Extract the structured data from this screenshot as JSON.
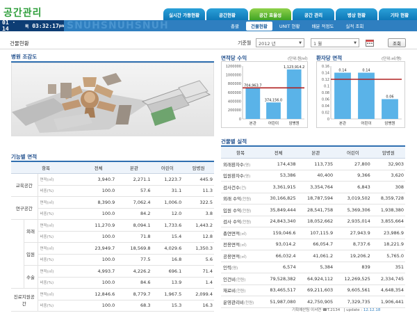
{
  "header": {
    "title": "공간관리",
    "tabs": [
      "실시간 가동현황",
      "공간현황",
      "공간 효율성",
      "공간 관리",
      "병상 현황",
      "기타 현황"
    ],
    "active_tab": 2,
    "clock": {
      "date": "01 · 14",
      "day": "목",
      "time": "03:32:17",
      "ampm": "pm"
    },
    "watermark": "SNUHSNUHSNUH",
    "subnav": [
      "총괄",
      "건물현황",
      "UNIT 현황",
      "배분 적정도",
      "실적 조회"
    ],
    "active_sub": 1
  },
  "filter": {
    "page_title": "건물현황",
    "year_label": "기준월",
    "year": "2012 년",
    "month": "1 월",
    "search": "조회"
  },
  "sections": {
    "map": "병원 조감도",
    "area_table": "기능별 면적",
    "rev_chart": "면적당 수익",
    "patient_chart": "환자당 면적",
    "perf_table": "건물별 실적"
  },
  "units": {
    "rev": "(단위:원/㎡)",
    "pat": "(단위:㎡/명)"
  },
  "colors": {
    "bar": "#5ab3e8",
    "ref_line": "#b02020",
    "header_blue": "#2f7fc0",
    "active_green": "#5cb82f"
  },
  "chart_data": [
    {
      "type": "bar",
      "title": "면적당 수익",
      "categories": [
        "본관",
        "어린이",
        "암병원"
      ],
      "values": [
        704963.7,
        374156.0,
        1123914.2
      ],
      "value_labels": [
        "704,963.7",
        "374,156.0",
        "1,123,914.2"
      ],
      "yticks": [
        "0",
        "200000",
        "400000",
        "600000",
        "800000",
        "1000000",
        "1200000"
      ],
      "ylim": [
        0,
        1200000
      ],
      "ref_line": 704963.7
    },
    {
      "type": "bar",
      "title": "환자당 면적",
      "categories": [
        "본관",
        "어린이",
        "암병원"
      ],
      "values": [
        0.14,
        0.14,
        0.06
      ],
      "value_labels": [
        "0.14",
        "0.14",
        "0.06"
      ],
      "yticks": [
        "0",
        "0.02",
        "0.04",
        "0.06",
        "0.08",
        "0.1",
        "0.12",
        "0.14",
        "0.16"
      ],
      "ylim": [
        0,
        0.16
      ],
      "ref_line": 0.12
    }
  ],
  "area_table": {
    "headers": [
      "항목",
      "",
      "전체",
      "본관",
      "어린이",
      "암병원"
    ],
    "rows": [
      {
        "g1": "교육공간",
        "g2": "",
        "m": "면적(㎡)",
        "v": [
          "3,940.7",
          "2,271.1",
          "1,223.7",
          "445.9"
        ]
      },
      {
        "g1": "",
        "g2": "",
        "m": "비중(%)",
        "v": [
          "100.0",
          "57.6",
          "31.1",
          "11.3"
        ]
      },
      {
        "g1": "연구공간",
        "g2": "",
        "m": "면적(㎡)",
        "v": [
          "8,390.9",
          "7,062.4",
          "1,006.0",
          "322.5"
        ]
      },
      {
        "g1": "",
        "g2": "",
        "m": "비중(%)",
        "v": [
          "100.0",
          "84.2",
          "12.0",
          "3.8"
        ]
      },
      {
        "g1": "",
        "g2": "외래",
        "m": "면적(㎡)",
        "v": [
          "11,270.9",
          "8,094.1",
          "1,733.6",
          "1,443.2"
        ]
      },
      {
        "g1": "",
        "g2": "",
        "m": "비중(%)",
        "v": [
          "100.0",
          "71.8",
          "15.4",
          "12.8"
        ]
      },
      {
        "g1": "진료공간",
        "g2": "입원",
        "m": "면적(㎡)",
        "v": [
          "23,949.7",
          "18,569.8",
          "4,029.6",
          "1,350.3"
        ]
      },
      {
        "g1": "",
        "g2": "",
        "m": "비중(%)",
        "v": [
          "100.0",
          "77.5",
          "16.8",
          "5.6"
        ]
      },
      {
        "g1": "",
        "g2": "수술",
        "m": "면적(㎡)",
        "v": [
          "4,993.7",
          "4,226.2",
          "696.1",
          "71.4"
        ]
      },
      {
        "g1": "",
        "g2": "",
        "m": "비중(%)",
        "v": [
          "100.0",
          "84.6",
          "13.9",
          "1.4"
        ]
      },
      {
        "g1": "진료지원공간",
        "g2": "",
        "m": "면적(㎡)",
        "v": [
          "12,846.6",
          "8,779.7",
          "1,967.5",
          "2,099.4"
        ]
      },
      {
        "g1": "",
        "g2": "",
        "m": "비중(%)",
        "v": [
          "100.0",
          "68.3",
          "15.3",
          "16.3"
        ]
      }
    ]
  },
  "perf_table": {
    "headers": [
      "항목",
      "전체",
      "본관",
      "어린이",
      "암병원"
    ],
    "rows": [
      {
        "n": "외래환자수",
        "u": "(명)",
        "v": [
          "174,438",
          "113,735",
          "27,800",
          "32,903"
        ]
      },
      {
        "n": "입원환자수",
        "u": "(명)",
        "v": [
          "53,386",
          "40,400",
          "9,366",
          "3,620"
        ]
      },
      {
        "n": "검사건수",
        "u": "(건)",
        "v": [
          "3,361,915",
          "3,354,764",
          "6,843",
          "308"
        ]
      },
      {
        "n": "외래 수익",
        "u": "(천원)",
        "v": [
          "30,166,825",
          "18,787,594",
          "3,019,502",
          "8,359,728"
        ]
      },
      {
        "n": "입원 수익",
        "u": "(천원)",
        "v": [
          "35,849,444",
          "28,541,758",
          "5,369,306",
          "1,938,380"
        ]
      },
      {
        "n": "검사 수익",
        "u": "(천원)",
        "v": [
          "24,843,340",
          "18,052,662",
          "2,935,014",
          "3,855,664"
        ]
      },
      {
        "n": "총연면적",
        "u": "(㎡)",
        "v": [
          "159,046.6",
          "107,115.9",
          "27,943.9",
          "23,986.9"
        ]
      },
      {
        "n": "전용면적",
        "u": "(㎡)",
        "v": [
          "93,014.2",
          "66,054.7",
          "8,737.6",
          "18,221.9"
        ]
      },
      {
        "n": "공용면적",
        "u": "(㎡)",
        "v": [
          "66,032.4",
          "41,061.2",
          "19,206.2",
          "5,765.0"
        ]
      },
      {
        "n": "인력",
        "u": "(명)",
        "v": [
          "6,574",
          "5,384",
          "839",
          "351"
        ]
      },
      {
        "n": "인건비",
        "u": "(천원)",
        "v": [
          "79,528,382",
          "64,924,112",
          "12,269,525",
          "2,334,745"
        ]
      },
      {
        "n": "재료비",
        "u": "(천원)",
        "v": [
          "83,465,517",
          "69,211,603",
          "9,605,561",
          "4,648,354"
        ]
      },
      {
        "n": "운영관리비",
        "u": "(천원)",
        "v": [
          "51,987,080",
          "42,750,905",
          "7,329,735",
          "1,906,441"
        ]
      }
    ]
  },
  "footer": {
    "contact": "기획예산팀 이서연",
    "tel": "T.2134",
    "update_label": "update :",
    "update": "12.12.18"
  }
}
